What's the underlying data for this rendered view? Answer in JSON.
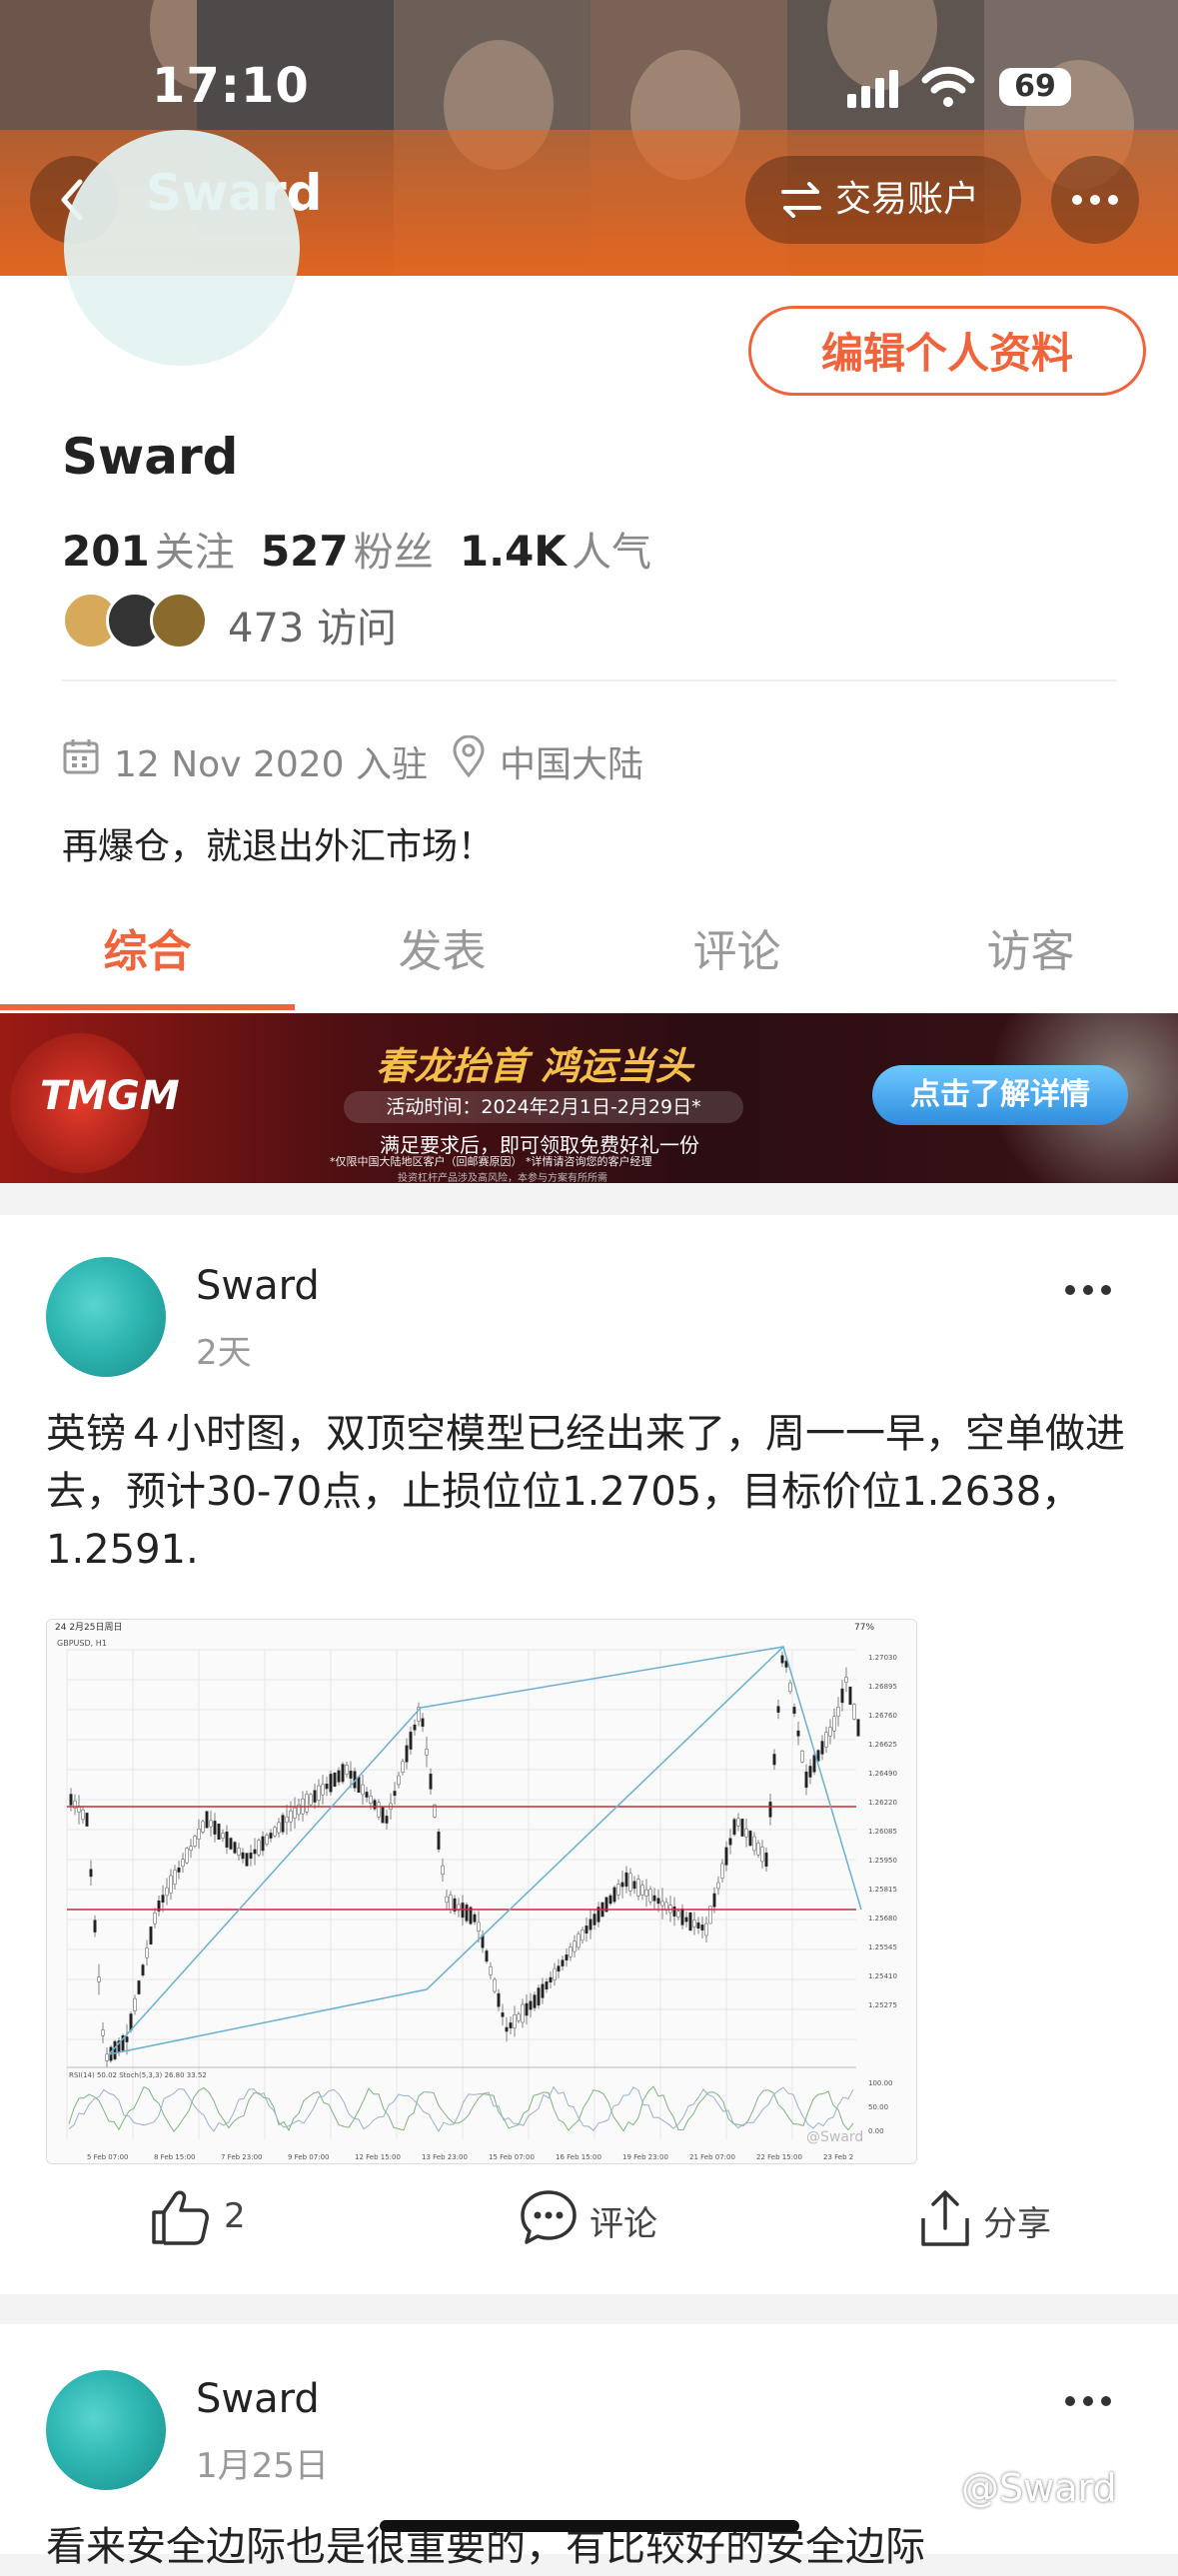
{
  "status_bar": {
    "time": "17:10",
    "battery": "69"
  },
  "header": {
    "title": "Sward",
    "trade_label": "交易账户"
  },
  "profile": {
    "name": "Sward",
    "edit_label": "编辑个人资料",
    "following_count": "201",
    "following_label": "关注",
    "followers_count": "527",
    "followers_label": "粉丝",
    "popularity_count": "1.4K",
    "popularity_label": "人气",
    "visits": "473 访问",
    "joined": "12 Nov 2020 入驻",
    "location": "中国大陆",
    "bio": "再爆仓，就退出外汇市场！"
  },
  "tabs": [
    {
      "label": "综合",
      "active": true
    },
    {
      "label": "发表",
      "active": false
    },
    {
      "label": "评论",
      "active": false
    },
    {
      "label": "访客",
      "active": false
    }
  ],
  "ad": {
    "brand": "TMGM",
    "title": "春龙抬首  鸿运当头",
    "period": "活动时间：2024年2月1日-2月29日*",
    "line2": "满足要求后，即可领取免费好礼一份",
    "line3": "*仅限中国大陆地区客户（回邮赛原因）  *详情请咨询您的客户经理",
    "line4": "投资杠杆产品涉及高风险，本参与方案有所所需",
    "button": "点击了解详情"
  },
  "posts": [
    {
      "author": "Sward",
      "time": "2天",
      "text": "英镑４小时图，双顶空模型已经出来了，周一一早，空单做进去，预计30-70点，止损位位1.2705，目标价位1.2638，1.2591.",
      "likes": "2",
      "comment_label": "评论",
      "share_label": "分享",
      "chart_image": {
        "header_left": "24   2月25日周日",
        "symbol": "GBPUSD, H1",
        "battery": "77%",
        "price_ticks": [
          "1.27030",
          "1.26895",
          "1.26760",
          "1.26625",
          "1.26490",
          "1.26220",
          "1.26085",
          "1.25950",
          "1.25815",
          "1.25680",
          "1.25545",
          "1.25410",
          "1.25275"
        ],
        "date_ticks": [
          "5 Feb 07:00",
          "8 Feb 15:00",
          "7 Feb 23:00",
          "9 Feb 07:00",
          "12 Feb 15:00",
          "13 Feb 23:00",
          "15 Feb 07:00",
          "16 Feb 15:00",
          "19 Feb 23:00",
          "21 Feb 07:00",
          "22 Feb 15:00",
          "23 Feb 2"
        ],
        "osc_label": "RSI(14) 50.02  Stoch(5,3,3) 26.80 33.52",
        "osc_ticks": [
          "100.00",
          "50.00",
          "0.00"
        ],
        "watermark": "@Sward"
      }
    },
    {
      "author": "Sward",
      "time": "1月25日",
      "text": "看来安全边际也是很重要的，有比较好的安全边际"
    }
  ],
  "watermark": "@Sward",
  "colors": {
    "accent": "#f0643c",
    "header": "#e8661f"
  }
}
